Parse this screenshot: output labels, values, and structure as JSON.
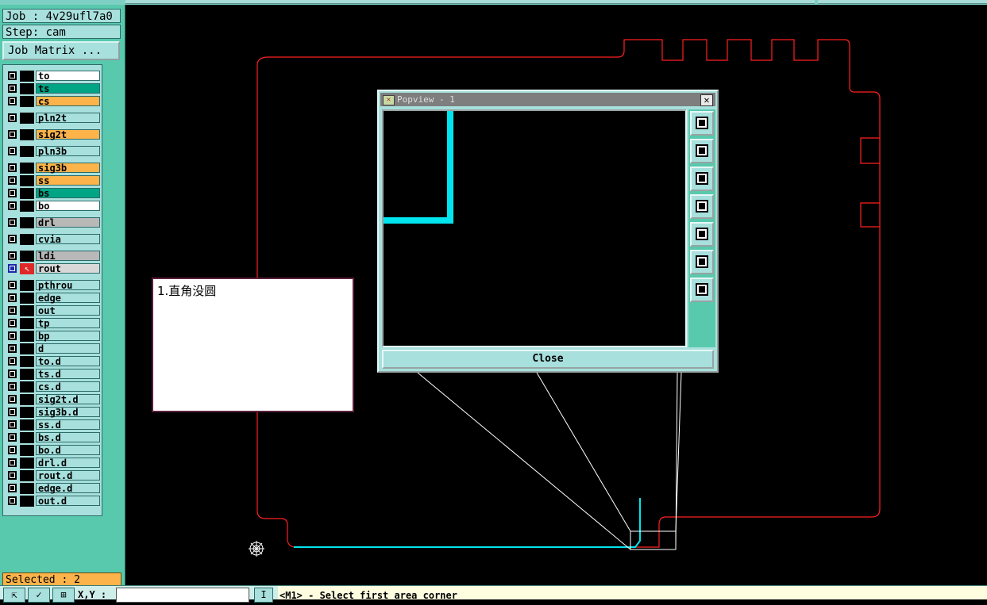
{
  "job": {
    "label": "Job : 4v29ufl7a0"
  },
  "step": {
    "label": "Step: cam"
  },
  "job_matrix_button": "Job Matrix ...",
  "layers": [
    {
      "name": "to",
      "color": "#ffffff"
    },
    {
      "name": "ts",
      "color": "#00a585"
    },
    {
      "name": "cs",
      "color": "#fbb34a"
    },
    {
      "name": "pln2t",
      "color": "#a7e0dd"
    },
    {
      "name": "sig2t",
      "color": "#fbb34a"
    },
    {
      "name": "pln3b",
      "color": "#a7e0dd"
    },
    {
      "name": "sig3b",
      "color": "#fbb34a"
    },
    {
      "name": "ss",
      "color": "#fbb34a"
    },
    {
      "name": "bs",
      "color": "#00a585"
    },
    {
      "name": "bo",
      "color": "#ffffff"
    },
    {
      "name": "drl",
      "color": "#b8b8b8"
    },
    {
      "name": "cvia",
      "color": "#a7e0dd"
    },
    {
      "name": "ldi",
      "color": "#b8b8b8"
    },
    {
      "name": "rout",
      "color": "#d8d8d8"
    },
    {
      "name": "pthrou",
      "color": "#a7e0dd"
    },
    {
      "name": "edge",
      "color": "#a7e0dd"
    },
    {
      "name": "out",
      "color": "#a7e0dd"
    },
    {
      "name": "tp",
      "color": "#a7e0dd"
    },
    {
      "name": "bp",
      "color": "#a7e0dd"
    },
    {
      "name": "d",
      "color": "#a7e0dd"
    },
    {
      "name": "to.d",
      "color": "#a7e0dd"
    },
    {
      "name": "ts.d",
      "color": "#a7e0dd"
    },
    {
      "name": "cs.d",
      "color": "#a7e0dd"
    },
    {
      "name": "sig2t.d",
      "color": "#a7e0dd"
    },
    {
      "name": "sig3b.d",
      "color": "#a7e0dd"
    },
    {
      "name": "ss.d",
      "color": "#a7e0dd"
    },
    {
      "name": "bs.d",
      "color": "#a7e0dd"
    },
    {
      "name": "bo.d",
      "color": "#a7e0dd"
    },
    {
      "name": "drl.d",
      "color": "#a7e0dd"
    },
    {
      "name": "rout.d",
      "color": "#a7e0dd"
    },
    {
      "name": "edge.d",
      "color": "#a7e0dd"
    },
    {
      "name": "out.d",
      "color": "#a7e0dd"
    }
  ],
  "active_layer": "rout",
  "selected": {
    "label": "Selected : 2"
  },
  "note": {
    "text": "1.直角没圆"
  },
  "popview": {
    "title": "Popview - 1",
    "close_label": "Close",
    "tools": [
      "zoom-fit-icon",
      "pan-up-icon",
      "pan-down-icon",
      "pan-left-icon",
      "pan-right-icon",
      "zoom-in-icon",
      "zoom-out-icon"
    ]
  },
  "bottombar": {
    "xy_label": "X,Y :",
    "info_label": "I",
    "status": "<M1> - Select first area corner"
  },
  "colors": {
    "panel": "#58c9ad",
    "profile": "#ff2020",
    "highlight": "#00e5ee"
  }
}
